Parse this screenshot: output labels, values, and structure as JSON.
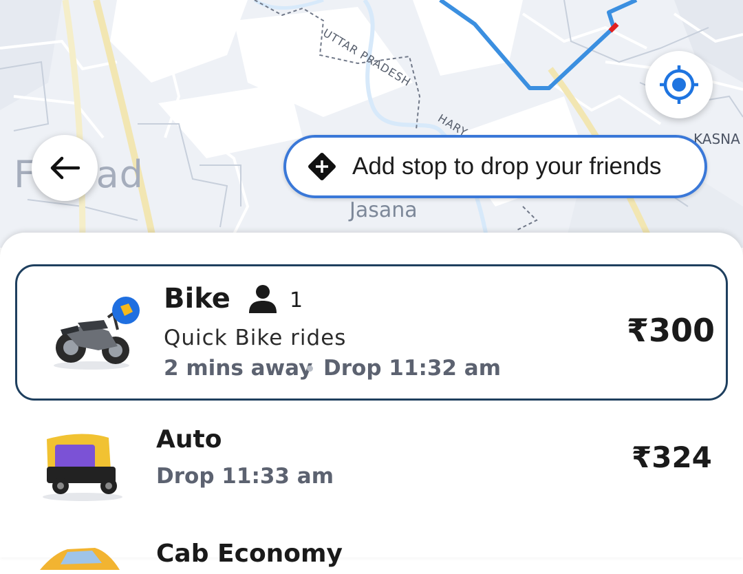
{
  "map": {
    "labels": {
      "city": "F   abad",
      "jasana": "Jasana",
      "uttar_pradesh": "UTTAR PRADESH",
      "haryana": "HARY",
      "kasna": "KASNA"
    },
    "colors": {
      "route": "#3b8fe0",
      "background": "#eef1f6",
      "road": "#f7f8fb",
      "major_road": "#f2e9c0"
    }
  },
  "add_stop": {
    "label": "Add stop to drop your friends",
    "icon": "directions-diamond-icon"
  },
  "back_button": {
    "icon": "arrow-left-icon"
  },
  "locate_button": {
    "icon": "crosshair-location-icon"
  },
  "rides": [
    {
      "name": "Bike",
      "capacity": "1",
      "description": "Quick Bike rides",
      "eta": "2 mins away",
      "drop": "Drop 11:32 am",
      "price": "₹300",
      "selected": true,
      "icon": "motorbike-icon"
    },
    {
      "name": "Auto",
      "drop": "Drop 11:33 am",
      "price": "₹324",
      "selected": false,
      "icon": "auto-rickshaw-icon"
    },
    {
      "name": "Cab Economy",
      "selected": false,
      "icon": "car-icon"
    }
  ],
  "colors": {
    "selected_border": "#1e3f5e",
    "accent": "#3a78d8",
    "meta_text": "#5c6270"
  }
}
